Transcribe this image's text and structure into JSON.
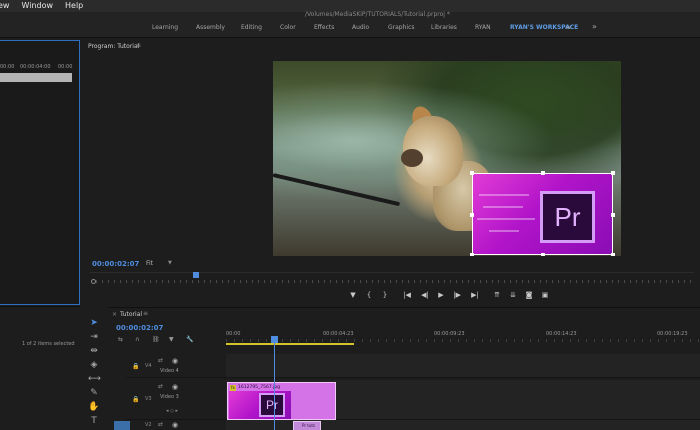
{
  "menubar": {
    "items": [
      "ew",
      "Window",
      "Help"
    ]
  },
  "path": "/Volumes/MediaSKiP/TUTORIALS/Tutorial.prproj *",
  "workspaces": {
    "tabs": [
      "Learning",
      "Assembly",
      "Editing",
      "Color",
      "Effects",
      "Audio",
      "Graphics",
      "Libraries",
      "RYAN",
      "RYAN'S WORKSPACE"
    ],
    "active": "RYAN'S WORKSPACE",
    "overflow": "»"
  },
  "source": {
    "timecodes": [
      "00:00",
      "00:00:04:00",
      "00:00"
    ]
  },
  "project": {
    "items_selected": "1 of 2 items selected"
  },
  "program": {
    "title": "Program: Tutorial",
    "menu_icon": "≡",
    "timecode": "00:00:02:07",
    "fit": "Fit",
    "overlay_logo": "Pr",
    "accent": "#4e8de0"
  },
  "transport": {
    "buttons": [
      "marker-icon",
      "mark-in-icon",
      "mark-out-icon",
      "go-to-in-icon",
      "step-back-icon",
      "play-icon",
      "step-forward-icon",
      "go-to-out-icon",
      "lift-icon",
      "extract-icon",
      "export-frame-icon",
      "compare-icon"
    ]
  },
  "timeline": {
    "close": "×",
    "title": "Tutorial",
    "menu_icon": "≡",
    "timecode": "00:00:02:07",
    "ruler": [
      "00:00",
      "00:00:04:23",
      "00:00:09:23",
      "00:00:14:23",
      "00:00:19:23"
    ],
    "tracks": [
      {
        "id": "V4",
        "name": "Video 4"
      },
      {
        "id": "V3",
        "name": "Video 3"
      },
      {
        "id": "V2",
        "name": ""
      }
    ],
    "clip_main": {
      "fx": "fx",
      "name": "1612795_7567.jpg",
      "logo": "Pr"
    },
    "clip_small": {
      "name": "Pr tuts"
    },
    "workarea_color": "#d6c32a"
  }
}
